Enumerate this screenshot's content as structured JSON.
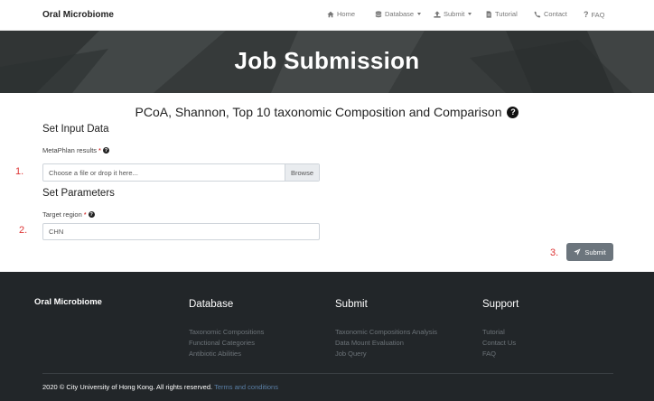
{
  "nav": {
    "brand": "Oral Microbiome",
    "items": [
      {
        "label": "Home",
        "icon": "home-icon"
      },
      {
        "label": "Database",
        "icon": "database-icon",
        "dropdown": true
      },
      {
        "label": "Submit",
        "icon": "upload-icon",
        "dropdown": true
      },
      {
        "label": "Tutorial",
        "icon": "file-icon"
      },
      {
        "label": "Contact",
        "icon": "phone-icon"
      },
      {
        "label": "FAQ",
        "icon": "question-icon"
      }
    ]
  },
  "hero": {
    "title": "Job Submission"
  },
  "form": {
    "title": "PCoA, Shannon, Top 10 taxonomic Composition and Comparison",
    "input_section": "Set Input Data",
    "metaphlan_label": "MetaPhlan results",
    "required_mark": "*",
    "file_placeholder": "Choose a file or drop it here...",
    "browse_label": "Browse",
    "param_section": "Set Parameters",
    "target_label": "Target region",
    "target_value": "CHN",
    "submit_label": "Submit",
    "step1": "1.",
    "step2": "2.",
    "step3": "3."
  },
  "footer": {
    "brand": "Oral Microbiome",
    "columns": [
      {
        "heading": "Database",
        "links": [
          "Taxonomic Compositions",
          "Functional Categories",
          "Antibiotic Abilities"
        ]
      },
      {
        "heading": "Submit",
        "links": [
          "Taxonomic Compositions Analysis",
          "Data Mount Evaluation",
          "Job Query"
        ]
      },
      {
        "heading": "Support",
        "links": [
          "Tutorial",
          "Contact Us",
          "FAQ"
        ]
      }
    ],
    "copyright": "2020 © City University of Hong Kong. All rights reserved.",
    "terms_link": "Terms and conditions"
  }
}
